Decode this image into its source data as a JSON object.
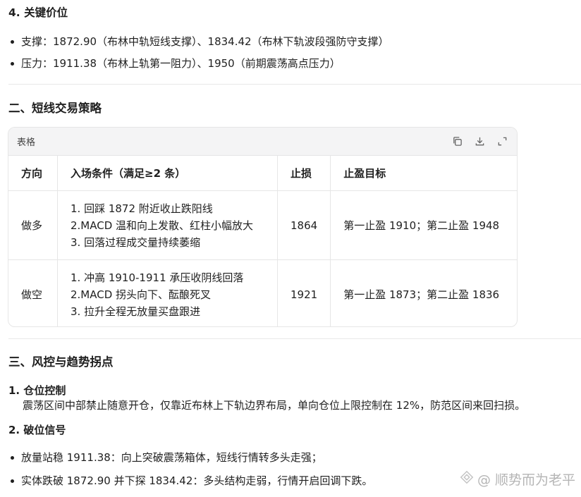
{
  "key_levels": {
    "title": "4. 关键价位",
    "items": [
      "支撑：1872.90（布林中轨短线支撑）、1834.42（布林下轨波段强防守支撑）",
      "压力：1911.38（布林上轨第一阻力）、1950（前期震荡高点压力）"
    ]
  },
  "strategy": {
    "title": "二、短线交易策略",
    "table_label": "表格",
    "headers": [
      "方向",
      "入场条件（满足≥2 条）",
      "止损",
      "止盈目标"
    ],
    "rows": [
      {
        "direction": "做多",
        "conditions": [
          "1. 回踩 1872 附近收止跌阳线",
          "2.MACD 温和向上发散、红柱小幅放大",
          "3. 回落过程成交量持续萎缩"
        ],
        "stop_loss": "1864",
        "target": "第一止盈 1910；第二止盈 1948"
      },
      {
        "direction": "做空",
        "conditions": [
          "1. 冲高 1910-1911 承压收阴线回落",
          "2.MACD 拐头向下、酝酿死叉",
          "3. 拉升全程无放量买盘跟进"
        ],
        "stop_loss": "1921",
        "target": "第一止盈 1873；第二止盈 1836"
      }
    ]
  },
  "risk": {
    "title": "三、风控与趋势拐点",
    "items": [
      {
        "heading": "1. 仓位控制",
        "body": "震荡区间中部禁止随意开仓，仅靠近布林上下轨边界布局，单向仓位上限控制在 12%，防范区间来回扫损。"
      },
      {
        "heading": "2. 破位信号",
        "body": ""
      }
    ],
    "signals": [
      "放量站稳 1911.38：向上突破震荡箱体，短线行情转多头走强；",
      "实体跌破 1872.90 并下探 1834.42：多头结构走弱，行情开启回调下跌。"
    ]
  },
  "watermark": "@ 顺势而为老平"
}
